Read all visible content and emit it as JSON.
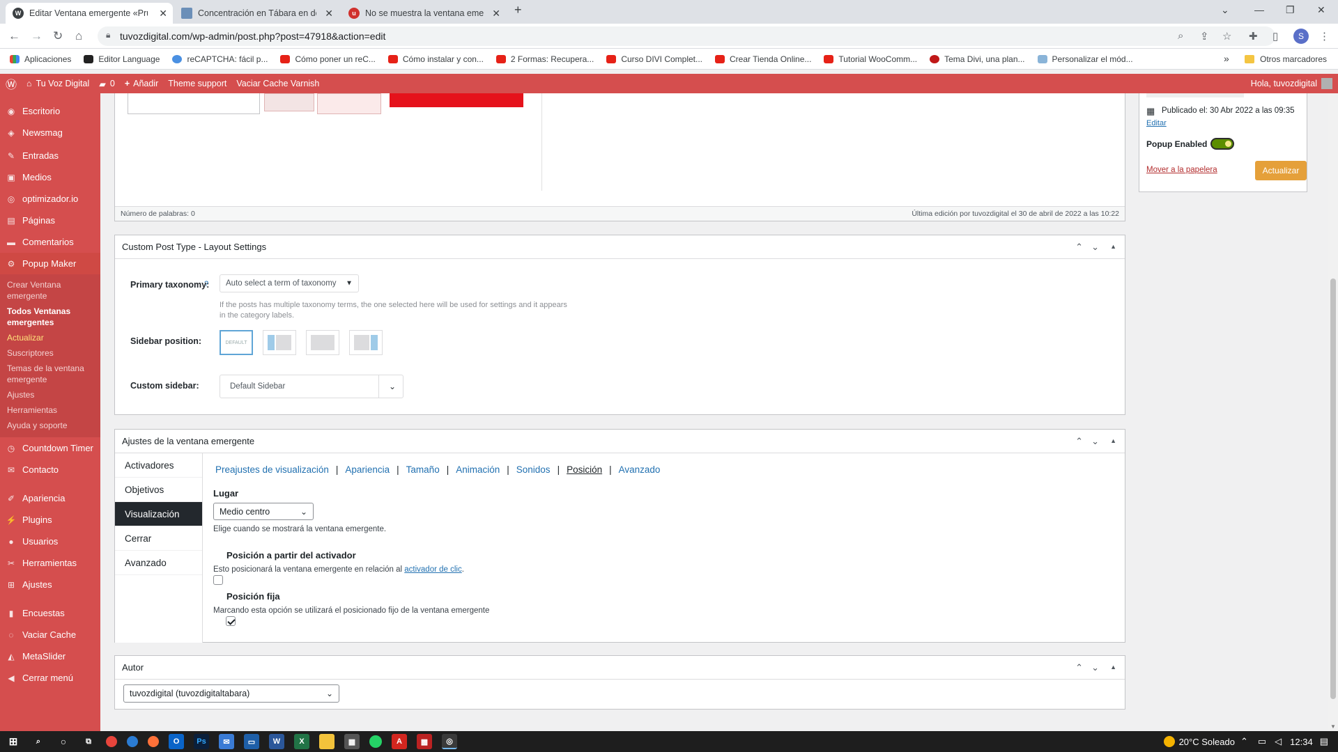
{
  "browser": {
    "tabs": [
      {
        "title": "Editar Ventana emergente «Prue",
        "active": true
      },
      {
        "title": "Concentración en Tábara en defe"
      },
      {
        "title": "No se muestra la ventana emerg"
      }
    ],
    "url": "tuvozdigital.com/wp-admin/post.php?post=47918&action=edit",
    "bookmarks": [
      "Aplicaciones",
      "Editor Language",
      "reCAPTCHA: fácil p...",
      "Cómo poner un reC...",
      "Cómo instalar y con...",
      "2 Formas: Recupera...",
      "Curso DIVI Complet...",
      "Crear Tienda Online...",
      "Tutorial WooComm...",
      "Tema Divi, una plan...",
      "Personalizar el mód..."
    ],
    "other_bookmarks": "Otros marcadores",
    "more": "»",
    "profile_initial": "S"
  },
  "adminbar": {
    "site": "Tu Voz Digital",
    "comments": "0",
    "add": "Añadir",
    "theme_support": "Theme support",
    "varnish": "Vaciar Cache Varnish",
    "greeting": "Hola, tuvozdigital"
  },
  "sidebar": {
    "items_top": [
      {
        "label": "Escritorio",
        "icon": "dashboard-icon",
        "glyph": "◉"
      },
      {
        "label": "Newsmag",
        "icon": "newsmag-icon",
        "glyph": "◈"
      },
      {
        "label": "Entradas",
        "icon": "pin-icon",
        "glyph": "✎"
      },
      {
        "label": "Medios",
        "icon": "media-icon",
        "glyph": "▣"
      },
      {
        "label": "optimizador.io",
        "icon": "optimizer-icon",
        "glyph": "◎"
      },
      {
        "label": "Páginas",
        "icon": "pages-icon",
        "glyph": "▤"
      },
      {
        "label": "Comentarios",
        "icon": "comments-icon",
        "glyph": "▬"
      },
      {
        "label": "Popup Maker",
        "icon": "popup-maker-icon",
        "glyph": "⚙"
      }
    ],
    "submenu": [
      {
        "label": "Crear Ventana emergente"
      },
      {
        "label": "Todos Ventanas emergentes",
        "bold": true
      },
      {
        "label": "Actualizar",
        "highlight": true
      },
      {
        "label": "Suscriptores"
      },
      {
        "label": "Temas de la ventana emergente"
      },
      {
        "label": "Ajustes"
      },
      {
        "label": "Herramientas"
      },
      {
        "label": "Ayuda y soporte"
      }
    ],
    "items_bottom": [
      {
        "label": "Countdown Timer",
        "icon": "clock-icon",
        "glyph": "◷"
      },
      {
        "label": "Contacto",
        "icon": "mail-icon",
        "glyph": "✉"
      },
      {
        "label": "Apariencia",
        "icon": "brush-icon",
        "glyph": "✐"
      },
      {
        "label": "Plugins",
        "icon": "plugin-icon",
        "glyph": "⚡"
      },
      {
        "label": "Usuarios",
        "icon": "users-icon",
        "glyph": "●"
      },
      {
        "label": "Herramientas",
        "icon": "tools-icon",
        "glyph": "✂"
      },
      {
        "label": "Ajustes",
        "icon": "settings-icon",
        "glyph": "⊞"
      },
      {
        "label": "Encuestas",
        "icon": "poll-icon",
        "glyph": "▮"
      },
      {
        "label": "Vaciar Cache",
        "icon": "cache-icon",
        "glyph": "◌"
      },
      {
        "label": "MetaSlider",
        "icon": "slider-icon",
        "glyph": "◭"
      },
      {
        "label": "Cerrar menú",
        "icon": "collapse-icon",
        "glyph": "◀"
      }
    ]
  },
  "editor": {
    "word_count": "Número de palabras: 0",
    "last_edit": "Última edición por tuvozdigital el 30 de abril de 2022 a las 10:22"
  },
  "publish": {
    "published": "Publicado el: 30 Abr 2022 a las 09:35",
    "edit": "Editar",
    "popup_enabled": "Popup Enabled",
    "trash": "Mover a la papelera",
    "update": "Actualizar"
  },
  "layout": {
    "title": "Custom Post Type - Layout Settings",
    "primary_tax_label": "Primary taxonomy:",
    "help_mark": "?",
    "primary_tax_value": "Auto select a term of taxonomy",
    "primary_tax_help": "If the posts has multiple taxonomy terms, the one selected here will be used for settings and it appears in the category labels.",
    "sidebar_pos_label": "Sidebar position:",
    "default_tile": "DEFAULT",
    "custom_sidebar_label": "Custom sidebar:",
    "custom_sidebar_value": "Default Sidebar"
  },
  "popup_settings": {
    "title": "Ajustes de la ventana emergente",
    "vtabs": [
      "Activadores",
      "Objetivos",
      "Visualización",
      "Cerrar",
      "Avanzado"
    ],
    "selected_vtab": "Visualización",
    "htabs": [
      "Preajustes de visualización",
      "Apariencia",
      "Tamaño",
      "Animación",
      "Sonidos",
      "Posición",
      "Avanzado"
    ],
    "active_htab": "Posición",
    "lugar_label": "Lugar",
    "lugar_value": "Medio centro",
    "lugar_help": "Elige cuando se mostrará la ventana emergente.",
    "pos_trigger_label": "Posición a partir del activador",
    "pos_trigger_checked": false,
    "pos_trigger_help_pre": "Esto posicionará la ventana emergente en relación al ",
    "pos_trigger_help_link": "activador de clic",
    "pos_trigger_help_post": ".",
    "pos_fixed_label": "Posición fija",
    "pos_fixed_checked": true,
    "pos_fixed_help": "Marcando esta opción se utilizará el posicionado fijo de la ventana emergente"
  },
  "author": {
    "title": "Autor",
    "value": "tuvozdigital (tuvozdigitaltabara)"
  },
  "taskbar": {
    "weather": "20°C Soleado",
    "time": "12:34"
  },
  "colors": {
    "accent": "#d54e4e",
    "update_button": "#e5a03a",
    "link": "#2271b1",
    "toggle": "#5c8e00"
  }
}
